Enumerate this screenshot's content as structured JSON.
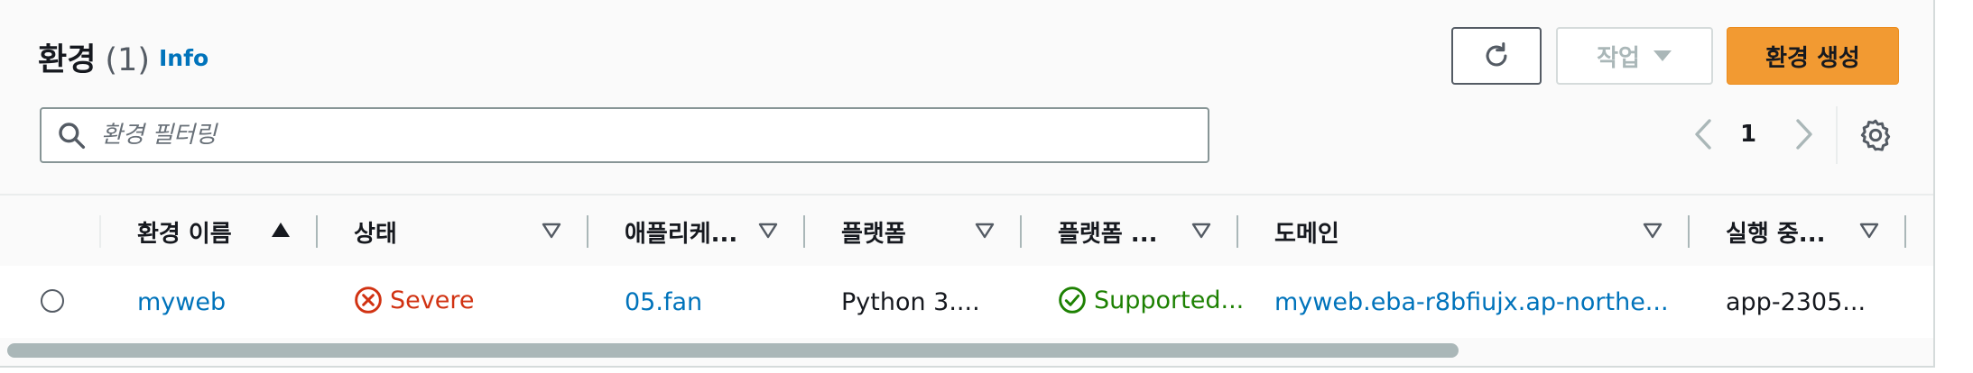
{
  "header": {
    "title": "환경",
    "count": "(1)",
    "info_label": "Info"
  },
  "toolbar": {
    "actions_label": "작업",
    "create_label": "환경 생성"
  },
  "search": {
    "placeholder": "환경 필터링"
  },
  "pagination": {
    "current_page": "1"
  },
  "table": {
    "columns": [
      {
        "label": "환경 이름",
        "sort": "ascending"
      },
      {
        "label": "상태",
        "sort": "none"
      },
      {
        "label": "애플리케...",
        "sort": "none"
      },
      {
        "label": "플랫폼",
        "sort": "none"
      },
      {
        "label": "플랫폼 ...",
        "sort": "none"
      },
      {
        "label": "도메인",
        "sort": "none"
      },
      {
        "label": "실행 중...",
        "sort": "none"
      }
    ],
    "rows": [
      {
        "name": "myweb",
        "status": "Severe",
        "application": "05.fan",
        "platform": "Python 3....",
        "platform_state": "Supported...",
        "domain": "myweb.eba-r8bfiujx.ap-northe...",
        "running_version": "app-2305..."
      }
    ]
  },
  "colors": {
    "accent": "#0073bb",
    "primary_button": "#f29a32",
    "severe": "#d13212",
    "supported": "#1d8102",
    "scrollbar": "#aab7b8"
  },
  "icons": {
    "refresh": "refresh-icon",
    "dropdown": "caret-down-icon",
    "search": "search-icon",
    "prev": "chevron-left-icon",
    "next": "chevron-right-icon",
    "settings": "gear-icon",
    "severe": "error-circle-icon",
    "supported": "check-circle-icon"
  }
}
